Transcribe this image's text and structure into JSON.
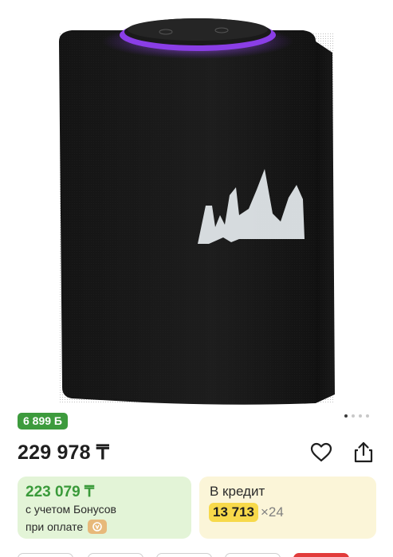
{
  "product": {
    "image_alt": "Smart speaker with purple light ring",
    "bonus_badge": "6 899 Б",
    "gallery": {
      "total": 4,
      "active": 1
    },
    "price": "229 978 ₸"
  },
  "bonus_card": {
    "price": "223 079 ₸",
    "line1": "с учетом Бонусов",
    "line2": "при оплате"
  },
  "credit_card": {
    "title": "В кредит",
    "amount": "13 713",
    "months": "×24"
  },
  "colors": {
    "bonus_green": "#3d9b3d",
    "bonus_card_bg": "#e3f4d7",
    "credit_card_bg": "#fbf5d8",
    "credit_pill": "#f7d94a",
    "speaker_light": "#9b4dff"
  },
  "icons": {
    "favorite": "heart-icon",
    "share": "share-icon",
    "pay": "bonus-pay-icon"
  }
}
